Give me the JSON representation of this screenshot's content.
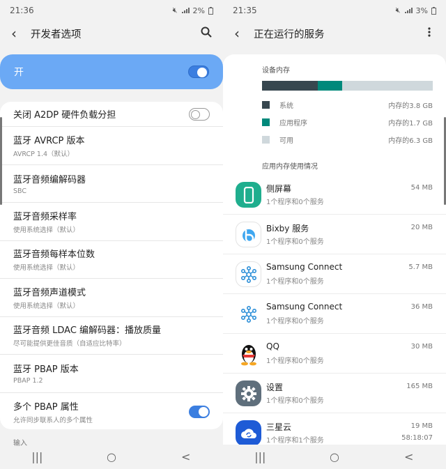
{
  "left": {
    "status": {
      "time": "21:36",
      "battery": "2%"
    },
    "appbar": {
      "title": "开发者选项"
    },
    "master": {
      "label": "开",
      "on": true
    },
    "settings": [
      {
        "title": "关闭 A2DP 硬件负载分担",
        "sub": "",
        "toggle": "off"
      },
      {
        "title": "蓝牙 AVRCP 版本",
        "sub": "AVRCP 1.4（默认）",
        "toggle": ""
      },
      {
        "title": "蓝牙音频编解码器",
        "sub": "SBC",
        "toggle": ""
      },
      {
        "title": "蓝牙音频采样率",
        "sub": "使用系统选择（默认）",
        "toggle": ""
      },
      {
        "title": "蓝牙音频每样本位数",
        "sub": "使用系统选择（默认）",
        "toggle": ""
      },
      {
        "title": "蓝牙音频声道模式",
        "sub": "使用系统选择（默认）",
        "toggle": ""
      },
      {
        "title": "蓝牙音频 LDAC 编解码器：播放质量",
        "sub": "尽可能提供更佳音质（自适应比特率）",
        "toggle": ""
      },
      {
        "title": "蓝牙 PBAP 版本",
        "sub": "PBAP 1.2",
        "toggle": ""
      },
      {
        "title": "多个 PBAP 属性",
        "sub": "允许同步联系人的多个属性",
        "toggle": "on"
      }
    ],
    "next_section": "输入"
  },
  "right": {
    "status": {
      "time": "21:35",
      "battery": "3%"
    },
    "appbar": {
      "title": "正在运行的服务"
    },
    "device_memory": {
      "title": "设备内存",
      "bar": [
        {
          "fraction": 0.3248,
          "color": "#37474f"
        },
        {
          "fraction": 0.1453,
          "color": "#00897b"
        },
        {
          "fraction": 0.5299,
          "color": "#cfd8dc"
        }
      ],
      "legend": [
        {
          "name": "系统",
          "value": "内存的3.8 GB",
          "color": "#37474f"
        },
        {
          "name": "应用程序",
          "value": "内存的1.7 GB",
          "color": "#00897b"
        },
        {
          "name": "可用",
          "value": "内存的6.3 GB",
          "color": "#cfd8dc"
        }
      ]
    },
    "app_memory_title": "应用内存使用情况",
    "apps": [
      {
        "name": "侧屏幕",
        "sub": "1个程序和0个服务",
        "size": "54 MB",
        "time": "",
        "icon": "edge-screen-icon"
      },
      {
        "name": "Bixby 服务",
        "sub": "1个程序和0个服务",
        "size": "20 MB",
        "time": "",
        "icon": "bixby-icon"
      },
      {
        "name": "Samsung Connect",
        "sub": "1个程序和0个服务",
        "size": "5.7 MB",
        "time": "",
        "icon": "samsung-connect-icon"
      },
      {
        "name": "Samsung Connect",
        "sub": "1个程序和0个服务",
        "size": "36 MB",
        "time": "",
        "icon": "samsung-connect-icon"
      },
      {
        "name": "QQ",
        "sub": "1个程序和0个服务",
        "size": "30 MB",
        "time": "",
        "icon": "qq-penguin-icon"
      },
      {
        "name": "设置",
        "sub": "1个程序和0个服务",
        "size": "165 MB",
        "time": "",
        "icon": "settings-gear-icon"
      },
      {
        "name": "三星云",
        "sub": "1个程序和1个服务",
        "size": "19 MB",
        "time": "58:18:07",
        "icon": "samsung-cloud-icon"
      }
    ]
  },
  "navbar": {
    "recents": "|||",
    "home": "○",
    "back": "<"
  },
  "icons": {
    "status_mute": "mute-icon",
    "status_signal": "signal-icon",
    "status_battery": "battery-icon",
    "left_search": "search-icon",
    "right_more": "more-vert-icon"
  }
}
